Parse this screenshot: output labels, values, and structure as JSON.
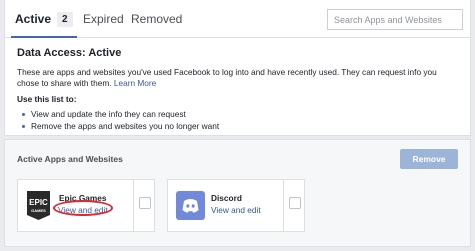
{
  "tabs": {
    "active_label": "Active",
    "active_count": "2",
    "expired_label": "Expired",
    "removed_label": "Removed"
  },
  "search": {
    "placeholder": "Search Apps and Websites",
    "value": ""
  },
  "info": {
    "title": "Data Access: Active",
    "description": "These are apps and websites you've used Facebook to log into and have recently used. They can request info you chose to share with them.",
    "learn_more": "Learn More",
    "use_title": "Use this list to:",
    "bullets": [
      "View and update the info they can request",
      "Remove the apps and websites you no longer want"
    ]
  },
  "section": {
    "title": "Active Apps and Websites",
    "remove_label": "Remove"
  },
  "apps": [
    {
      "name": "Epic Games",
      "link": "View and edit",
      "logo_line1": "EPIC",
      "logo_line2": "GAMES",
      "icon": "epic-games-logo"
    },
    {
      "name": "Discord",
      "link": "View and edit",
      "icon": "discord-logo"
    }
  ],
  "colors": {
    "accent": "#4267b2",
    "link": "#365899",
    "disabled_button": "#9cb4d8",
    "annotation": "#e0262e",
    "discord": "#7289da"
  }
}
